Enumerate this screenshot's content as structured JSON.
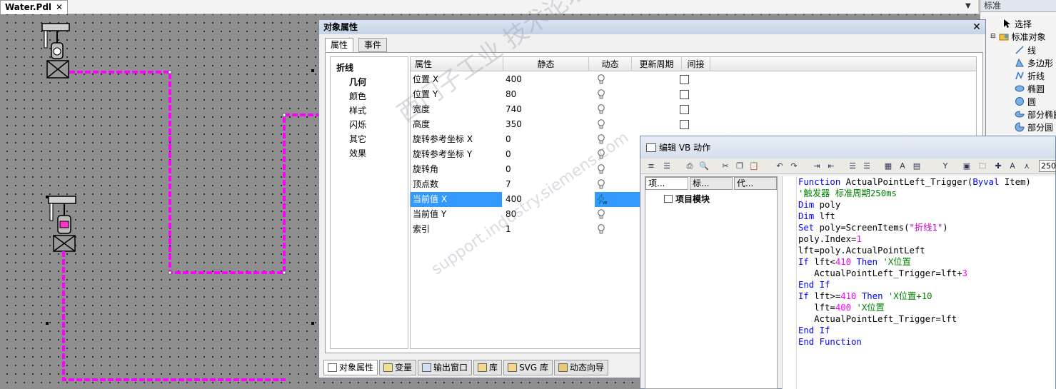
{
  "document_tab": {
    "title": "Water.Pdl",
    "close": "✕"
  },
  "tab_dropdown": "▼",
  "objects_panel": {
    "header": "标准",
    "items": [
      {
        "label": "选择",
        "icon": "cursor-icon"
      },
      {
        "label": "标准对象",
        "icon": "folder-icon"
      },
      {
        "label": "线",
        "icon": "line-icon"
      },
      {
        "label": "多边形",
        "icon": "polygon-icon"
      },
      {
        "label": "折线",
        "icon": "polyline-icon"
      },
      {
        "label": "椭圆",
        "icon": "ellipse-icon"
      },
      {
        "label": "圆",
        "icon": "circle-icon"
      },
      {
        "label": "部分椭圆",
        "icon": "partial-ellipse-icon"
      },
      {
        "label": "部分圆",
        "icon": "partial-circle-icon"
      }
    ]
  },
  "properties_window": {
    "title": "对象属性",
    "close": "✕",
    "tabs": [
      "属性",
      "事件"
    ],
    "categories": {
      "root": "折线",
      "children": [
        "几何",
        "颜色",
        "样式",
        "闪烁",
        "其它",
        "效果"
      ],
      "selected": "几何"
    },
    "columns": [
      "属性",
      "静态",
      "动态",
      "更新周期",
      "间接"
    ],
    "rows": [
      {
        "name": "位置 X",
        "static": "400"
      },
      {
        "name": "位置 Y",
        "static": "80"
      },
      {
        "name": "宽度",
        "static": "740"
      },
      {
        "name": "高度",
        "static": "350"
      },
      {
        "name": "旋转参考坐标 X",
        "static": "0"
      },
      {
        "name": "旋转参考坐标 Y",
        "static": "0"
      },
      {
        "name": "旋转角",
        "static": "0"
      },
      {
        "name": "顶点数",
        "static": "7"
      },
      {
        "name": "当前值 X",
        "static": "400",
        "selected": true,
        "dynamic": "vb-action-icon"
      },
      {
        "name": "当前值 Y",
        "static": "80"
      },
      {
        "name": "索引",
        "static": "1"
      }
    ],
    "bottom_tabs": [
      "对象属性",
      "变量",
      "输出窗口",
      "库",
      "SVG 库",
      "动态向导"
    ]
  },
  "vb_editor": {
    "title": "编辑 VB 动作",
    "zoom": "250",
    "left_tabs": [
      "项...",
      "标...",
      "代..."
    ],
    "tree_item": "项目模块",
    "code_lines": [
      [
        [
          "kw",
          "Function"
        ],
        [
          "t",
          " ActualPointLeft_Trigger("
        ],
        [
          "kw",
          "Byval"
        ],
        [
          "t",
          " Item)"
        ]
      ],
      [
        [
          "cm",
          "'触发器 标准周期250ms"
        ]
      ],
      [
        [
          "kw",
          "Dim"
        ],
        [
          "t",
          " poly"
        ]
      ],
      [
        [
          "kw",
          "Dim"
        ],
        [
          "t",
          " lft"
        ]
      ],
      [
        [
          "kw",
          "Set"
        ],
        [
          "t",
          " poly=ScreenItems("
        ],
        [
          "st",
          "\"折线1\""
        ],
        [
          "t",
          ")"
        ]
      ],
      [
        [
          "t",
          "poly.Index="
        ],
        [
          "num",
          "1"
        ]
      ],
      [
        [
          "t",
          "lft=poly.ActualPointLeft"
        ]
      ],
      [
        [
          "kw",
          "If"
        ],
        [
          "t",
          " lft<"
        ],
        [
          "num",
          "410"
        ],
        [
          "t",
          " "
        ],
        [
          "kw",
          "Then"
        ],
        [
          "t",
          " "
        ],
        [
          "cm",
          "'X位置"
        ]
      ],
      [
        [
          "t",
          "   ActualPointLeft_Trigger=lft+"
        ],
        [
          "num",
          "3"
        ]
      ],
      [
        [
          "kw",
          "End If"
        ]
      ],
      [
        [
          "kw",
          "If"
        ],
        [
          "t",
          " lft>="
        ],
        [
          "num",
          "410"
        ],
        [
          "t",
          " "
        ],
        [
          "kw",
          "Then"
        ],
        [
          "t",
          " "
        ],
        [
          "cm",
          "'X位置+10"
        ]
      ],
      [
        [
          "t",
          "   lft="
        ],
        [
          "num",
          "400"
        ],
        [
          "t",
          " "
        ],
        [
          "cm",
          "'X位置"
        ]
      ],
      [
        [
          "t",
          "   ActualPointLeft_Trigger=lft"
        ]
      ],
      [
        [
          "kw",
          "End If"
        ]
      ],
      [
        [
          "kw",
          "End Function"
        ]
      ]
    ]
  },
  "watermark": {
    "line1": "西门子工业 技术论坛",
    "line2": "support.industry.siemens.com"
  },
  "colors": {
    "polyline": "#ff00ff",
    "selection": "#3399ff",
    "keyword": "#0000ff",
    "comment": "#008000"
  }
}
